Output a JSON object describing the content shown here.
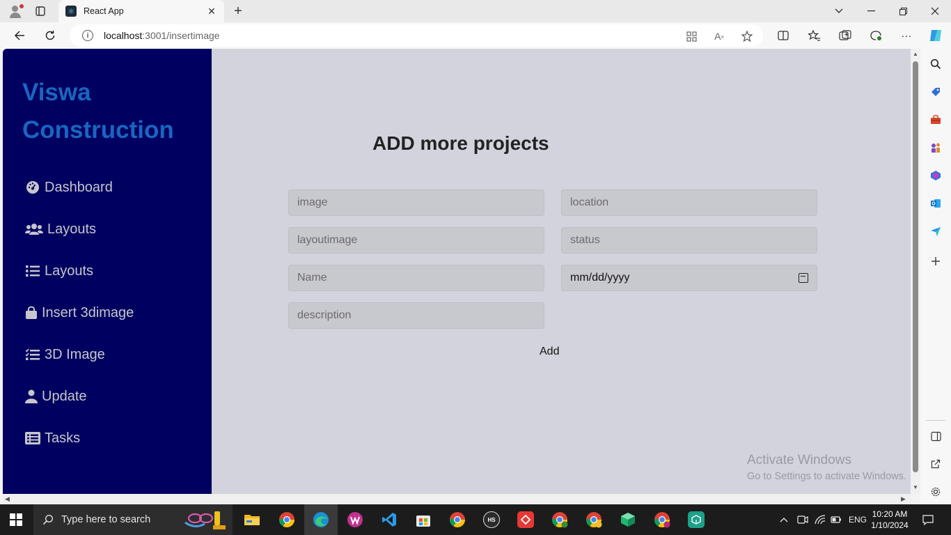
{
  "browser": {
    "tab_title": "React App",
    "url_host": "localhost",
    "url_path": ":3001/insertimage",
    "colors": {
      "accent": "#0078d4"
    }
  },
  "app": {
    "brand_line1": "Viswa",
    "brand_line2": "Construction",
    "nav": [
      {
        "label": "Dashboard",
        "icon": "dashboard-icon"
      },
      {
        "label": "Layouts",
        "icon": "users-icon"
      },
      {
        "label": "Layouts",
        "icon": "list-icon"
      },
      {
        "label": "Insert 3dimage",
        "icon": "bag-icon"
      },
      {
        "label": "3D Image",
        "icon": "checklist-icon"
      },
      {
        "label": "Update",
        "icon": "user-icon"
      },
      {
        "label": "Tasks",
        "icon": "tasks-icon"
      }
    ],
    "colors": {
      "sidebar_bg": "#000060",
      "brand": "#1a65c0",
      "main_bg": "#d3d3dd"
    }
  },
  "form": {
    "heading": "ADD more projects",
    "fields": {
      "image": {
        "placeholder": "image"
      },
      "location": {
        "placeholder": "location"
      },
      "layoutimage": {
        "placeholder": "layoutimage"
      },
      "status": {
        "placeholder": "status"
      },
      "name": {
        "placeholder": "Name"
      },
      "date": {
        "placeholder": "mm/dd/yyyy"
      },
      "description": {
        "placeholder": "description"
      }
    },
    "submit_label": "Add"
  },
  "watermark": {
    "line1": "Activate Windows",
    "line2": "Go to Settings to activate Windows."
  },
  "taskbar": {
    "search_placeholder": "Type here to search",
    "language": "ENG",
    "time": "10:20 AM",
    "date": "1/10/2024"
  }
}
